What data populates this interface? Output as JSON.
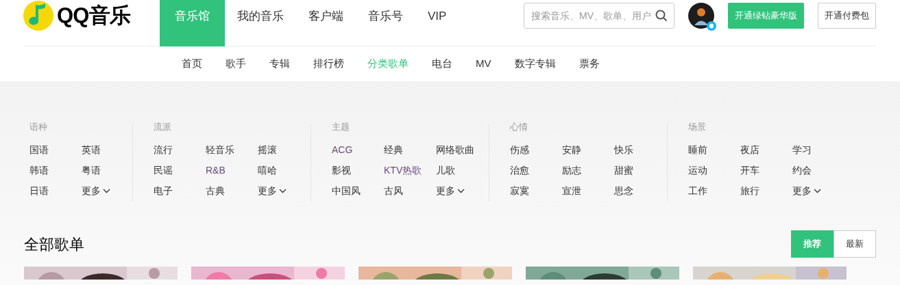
{
  "logo": {
    "text": "QQ音乐"
  },
  "main_nav": [
    {
      "label": "音乐馆",
      "selected": true
    },
    {
      "label": "我的音乐",
      "selected": false
    },
    {
      "label": "客户端",
      "selected": false
    },
    {
      "label": "音乐号",
      "selected": false
    },
    {
      "label": "VIP",
      "selected": false
    }
  ],
  "search": {
    "placeholder": "搜索音乐、MV、歌单、用户"
  },
  "vip_button": "开通绿钻豪华版",
  "pay_button": "开通付费包",
  "sub_nav": [
    {
      "label": "首页",
      "selected": false
    },
    {
      "label": "歌手",
      "selected": false
    },
    {
      "label": "专辑",
      "selected": false
    },
    {
      "label": "排行榜",
      "selected": false
    },
    {
      "label": "分类歌单",
      "selected": true
    },
    {
      "label": "电台",
      "selected": false
    },
    {
      "label": "MV",
      "selected": false
    },
    {
      "label": "数字专辑",
      "selected": false
    },
    {
      "label": "票务",
      "selected": false
    }
  ],
  "categories": [
    {
      "title": "语种",
      "more": "更多",
      "tags": [
        {
          "label": "国语",
          "visited": false
        },
        {
          "label": "英语",
          "visited": false
        },
        {
          "label": "韩语",
          "visited": false
        },
        {
          "label": "粤语",
          "visited": false
        },
        {
          "label": "日语",
          "visited": false
        }
      ]
    },
    {
      "title": "流派",
      "more": "更多",
      "tags": [
        {
          "label": "流行",
          "visited": false
        },
        {
          "label": "轻音乐",
          "visited": false
        },
        {
          "label": "摇滚",
          "visited": false
        },
        {
          "label": "民谣",
          "visited": false
        },
        {
          "label": "R&B",
          "visited": true
        },
        {
          "label": "嘻哈",
          "visited": false
        },
        {
          "label": "电子",
          "visited": false
        },
        {
          "label": "古典",
          "visited": false
        }
      ]
    },
    {
      "title": "主题",
      "more": "更多",
      "tags": [
        {
          "label": "ACG",
          "visited": true
        },
        {
          "label": "经典",
          "visited": false
        },
        {
          "label": "网络歌曲",
          "visited": false
        },
        {
          "label": "影视",
          "visited": false
        },
        {
          "label": "KTV热歌",
          "visited": true
        },
        {
          "label": "儿歌",
          "visited": false
        },
        {
          "label": "中国风",
          "visited": false
        },
        {
          "label": "古风",
          "visited": false
        }
      ]
    },
    {
      "title": "心情",
      "tags": [
        {
          "label": "伤感",
          "visited": false
        },
        {
          "label": "安静",
          "visited": false
        },
        {
          "label": "快乐",
          "visited": false
        },
        {
          "label": "治愈",
          "visited": false
        },
        {
          "label": "励志",
          "visited": false
        },
        {
          "label": "甜蜜",
          "visited": false
        },
        {
          "label": "寂寞",
          "visited": false
        },
        {
          "label": "宣泄",
          "visited": false
        },
        {
          "label": "思念",
          "visited": false
        }
      ]
    },
    {
      "title": "场景",
      "more": "更多",
      "tags": [
        {
          "label": "睡前",
          "visited": false
        },
        {
          "label": "夜店",
          "visited": false
        },
        {
          "label": "学习",
          "visited": false
        },
        {
          "label": "运动",
          "visited": false
        },
        {
          "label": "开车",
          "visited": false
        },
        {
          "label": "约会",
          "visited": false
        },
        {
          "label": "工作",
          "visited": false
        },
        {
          "label": "旅行",
          "visited": false
        }
      ]
    }
  ],
  "section_title": "全部歌单",
  "sort_tabs": [
    {
      "label": "推荐",
      "selected": true
    },
    {
      "label": "最新",
      "selected": false
    }
  ]
}
